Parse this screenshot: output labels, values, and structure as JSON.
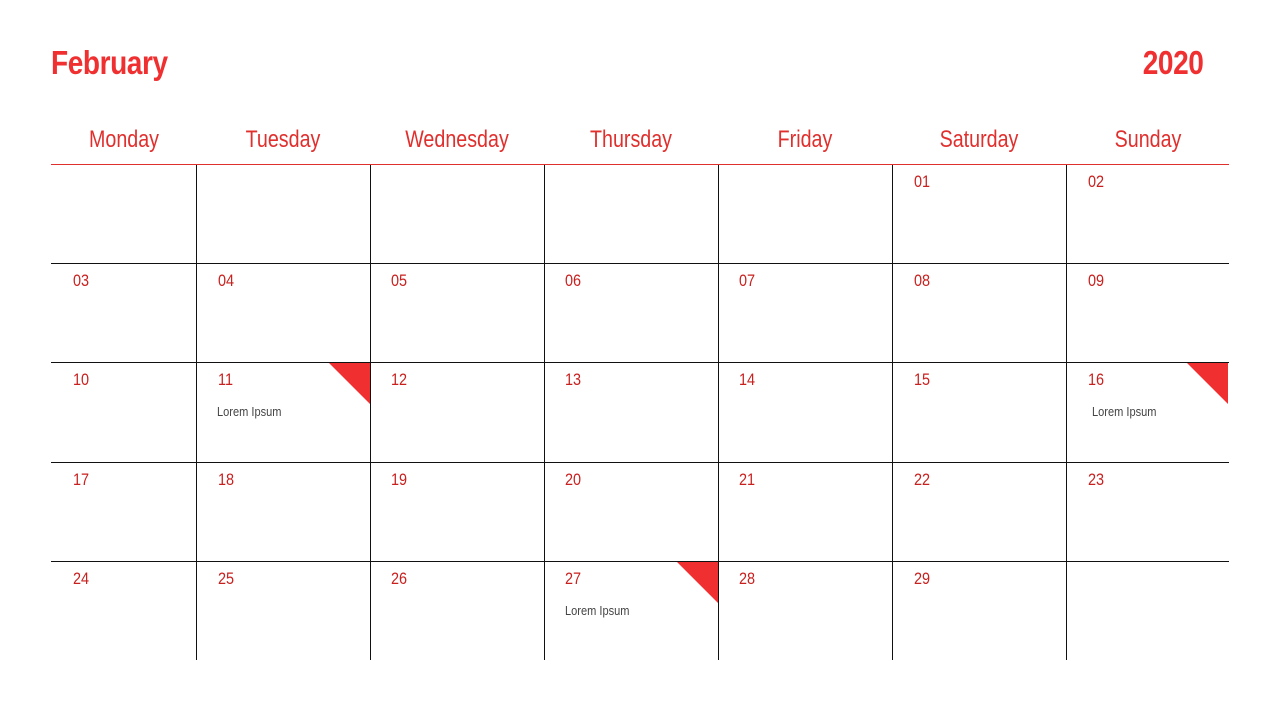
{
  "header": {
    "month": "February",
    "year": "2020"
  },
  "weekdays": [
    "Monday",
    "Tuesday",
    "Wednesday",
    "Thursday",
    "Friday",
    "Saturday",
    "Sunday"
  ],
  "accent_color": "#f03030",
  "weeks": [
    [
      "",
      "",
      "",
      "",
      "",
      "01",
      "02"
    ],
    [
      "03",
      "04",
      "05",
      "06",
      "07",
      "08",
      "09"
    ],
    [
      "10",
      "11",
      "12",
      "13",
      "14",
      "15",
      "16"
    ],
    [
      "17",
      "18",
      "19",
      "20",
      "21",
      "22",
      "23"
    ],
    [
      "24",
      "25",
      "26",
      "27",
      "28",
      "29",
      ""
    ]
  ],
  "events": [
    {
      "week": 2,
      "day": 1,
      "date": "11",
      "label": "Lorem Ipsum"
    },
    {
      "week": 2,
      "day": 6,
      "date": "16",
      "label": "Lorem Ipsum"
    },
    {
      "week": 4,
      "day": 3,
      "date": "27",
      "label": "Lorem Ipsum"
    }
  ]
}
